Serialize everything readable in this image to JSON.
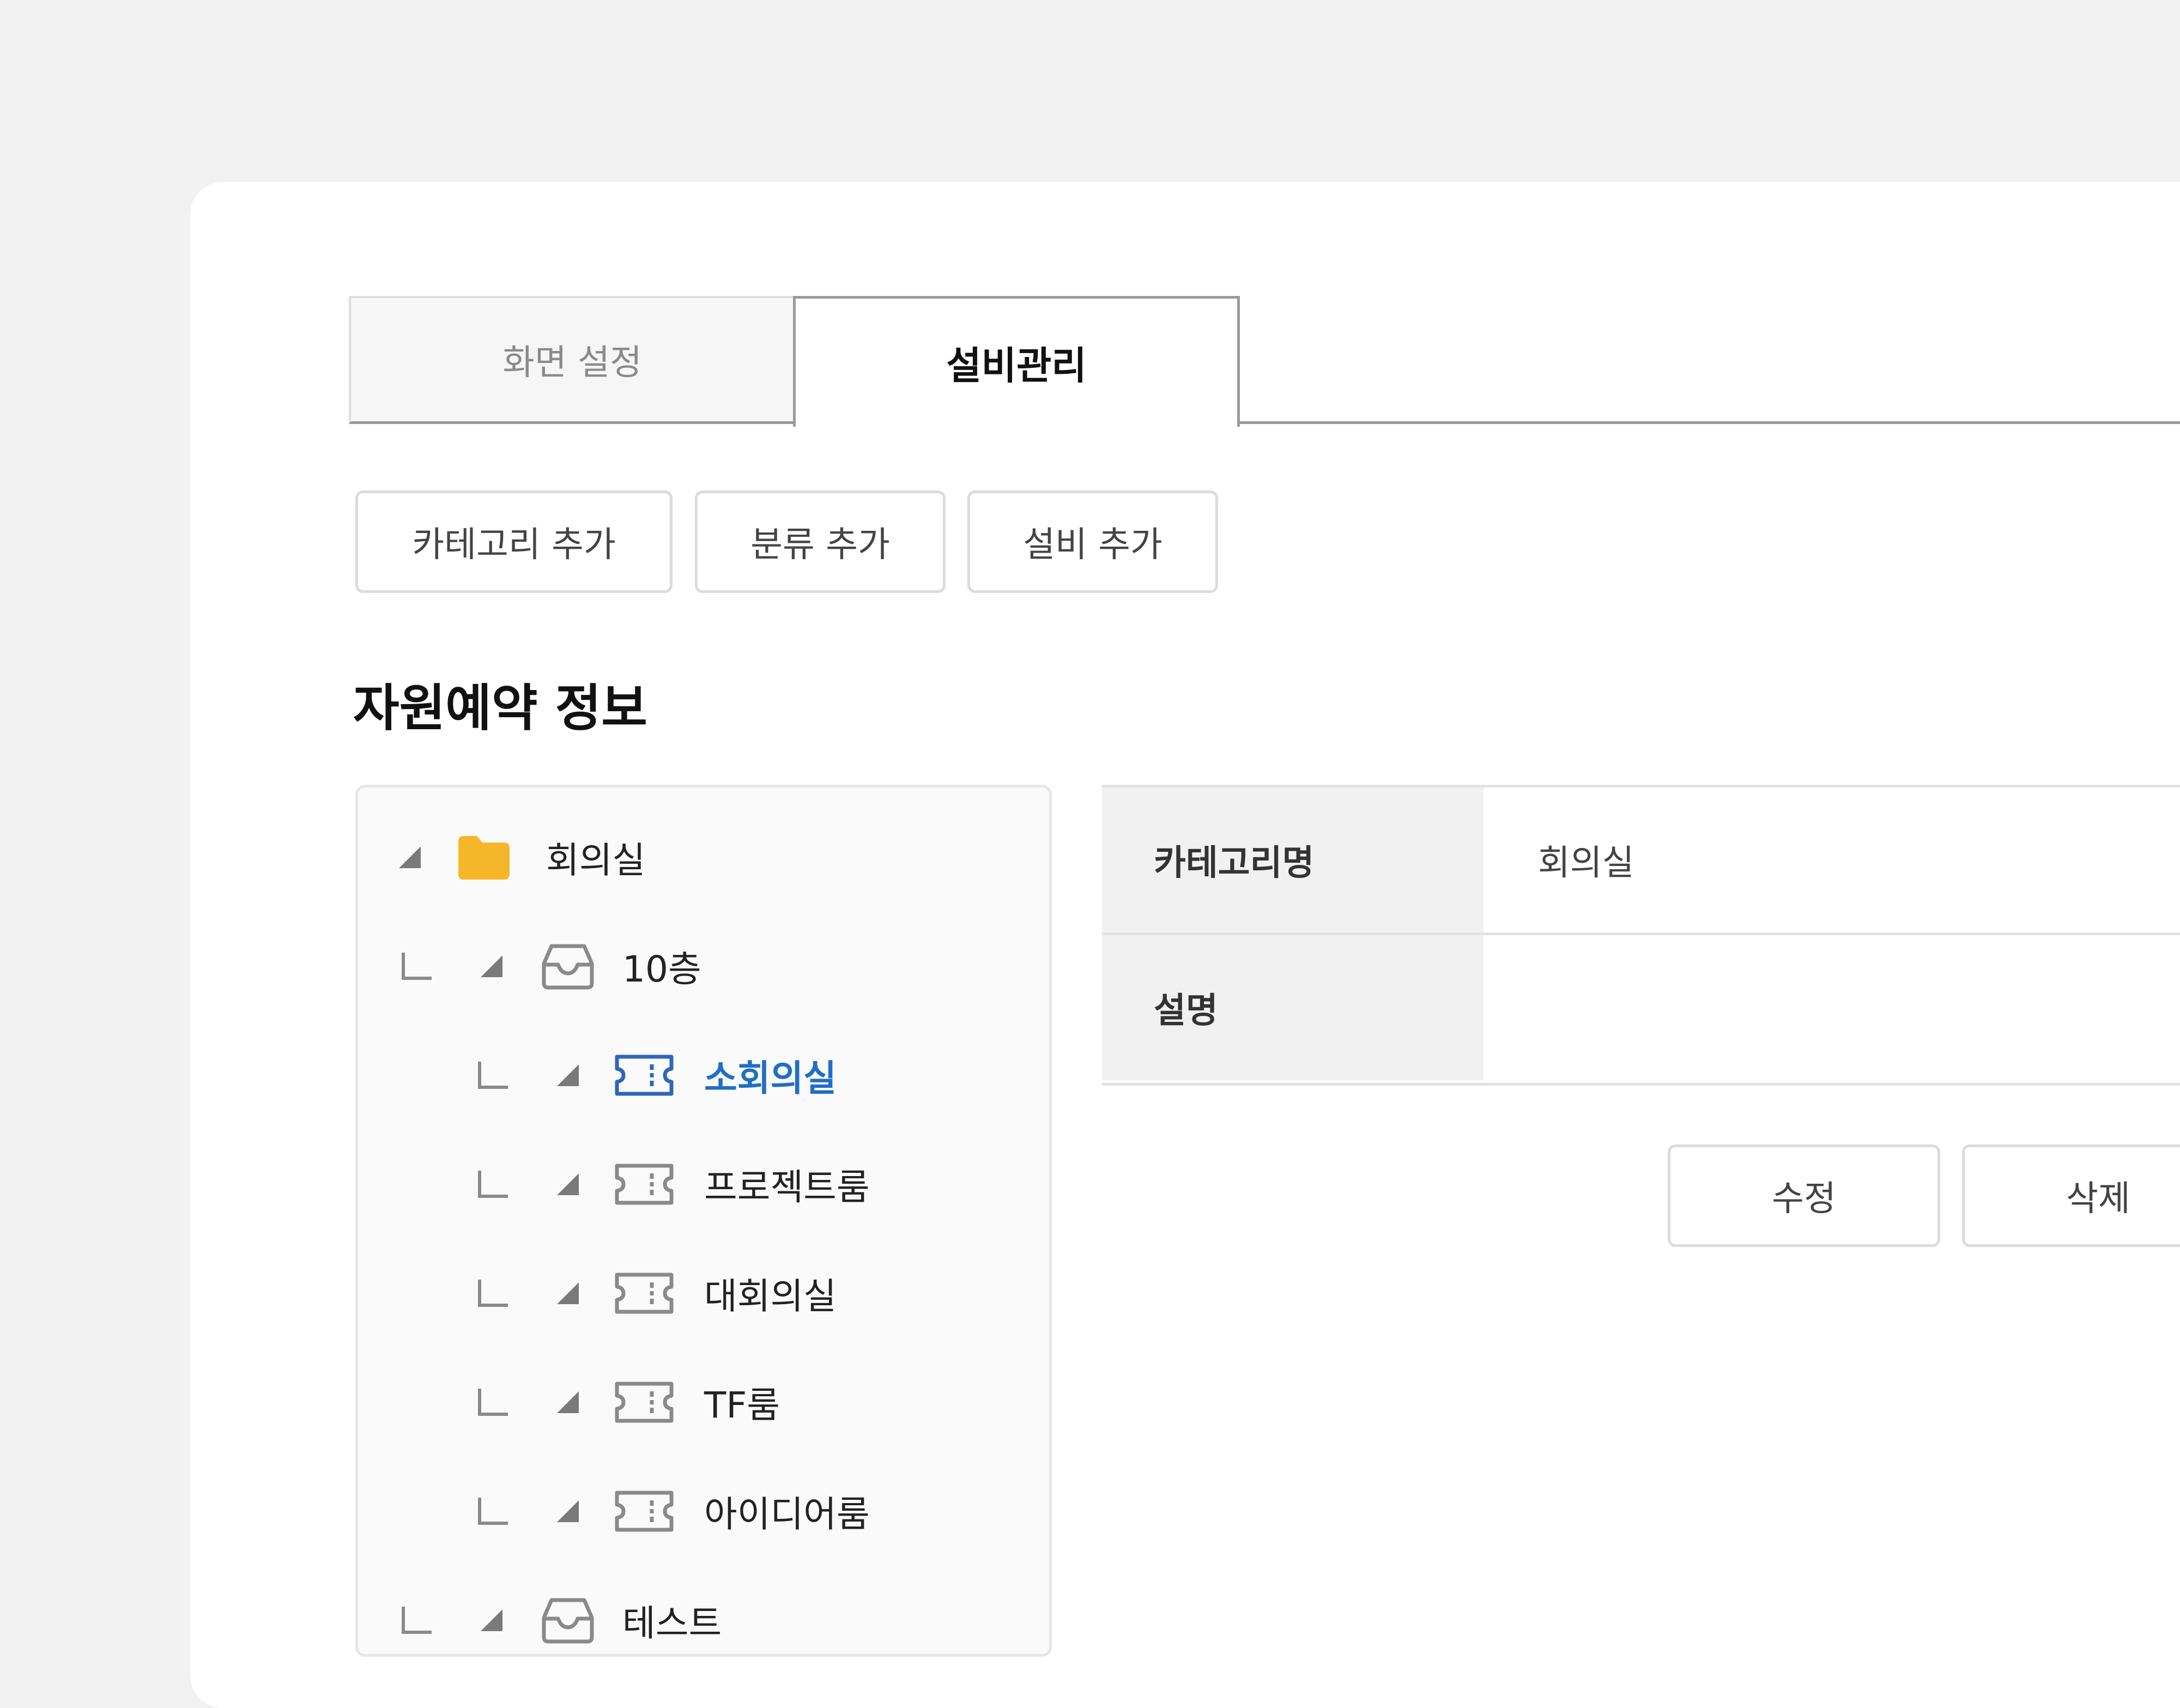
{
  "tabs": [
    {
      "label": "화면 설정",
      "active": false
    },
    {
      "label": "설비관리",
      "active": true
    }
  ],
  "actions": {
    "add_category": "카테고리 추가",
    "add_class": "분류 추가",
    "add_equipment": "설비 추가"
  },
  "section_title": "자원예약 정보",
  "tree": {
    "root": {
      "label": "회의실",
      "icon": "folder-icon"
    },
    "floor": {
      "label": "10층",
      "icon": "inbox-tray-icon"
    },
    "rooms": [
      {
        "label": "소회의실",
        "icon": "ticket-icon",
        "selected": true
      },
      {
        "label": "프로젝트룸",
        "icon": "ticket-icon",
        "selected": false
      },
      {
        "label": "대회의실",
        "icon": "ticket-icon",
        "selected": false
      },
      {
        "label": "TF룸",
        "icon": "ticket-icon",
        "selected": false
      },
      {
        "label": "아이디어룸",
        "icon": "ticket-icon",
        "selected": false
      }
    ],
    "second_group": {
      "label": "테스트",
      "icon": "inbox-tray-icon"
    }
  },
  "detail": {
    "category_name_label": "카테고리명",
    "category_name_value": "회의실",
    "description_label": "설명",
    "description_value": ""
  },
  "buttons": {
    "edit": "수정",
    "delete": "삭제"
  },
  "colors": {
    "selected_text": "#1f6fc4",
    "folder": "#f6b62a",
    "tree_icon": "#8a8a8a"
  }
}
